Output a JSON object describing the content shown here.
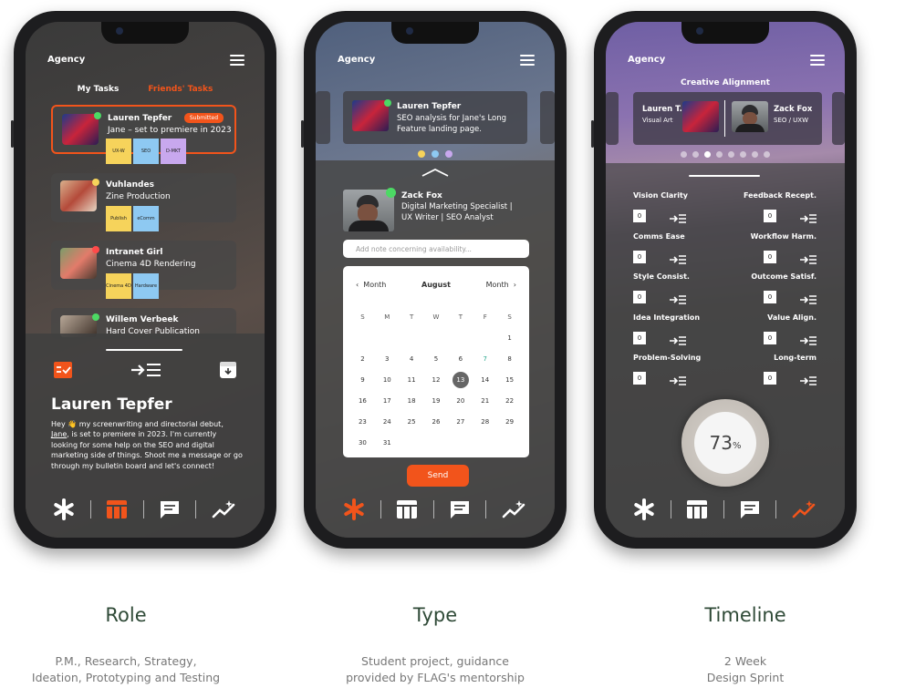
{
  "phone1": {
    "brand": "Agency",
    "tabs": [
      "My Tasks",
      "Friends' Tasks"
    ],
    "cards": [
      {
        "name": "Lauren Tepfer",
        "desc": "Jane – set to premiere in 2023",
        "badge": "Submitted",
        "stickies": [
          "UX-W",
          "SEO",
          "D-MKT"
        ]
      },
      {
        "name": "Vuhlandes",
        "desc": "Zine Production",
        "stickies": [
          "Publish",
          "eComm"
        ]
      },
      {
        "name": "Intranet Girl",
        "desc": "Cinema 4D Rendering",
        "stickies": [
          "Cinema 4D",
          "Hardware"
        ]
      },
      {
        "name": "Willem Verbeek",
        "desc": "Hard Cover Publication"
      }
    ],
    "detail_name": "Lauren Tepfer",
    "message_start": "Hey 👋 my screenwriting and directorial debut,",
    "message_link": "Jane",
    "message_end": ", is set to premiere in 2023. I'm currently looking for some help on the SEO and digital marketing side of things. Shoot me a message or go through my bulletin board and let's connect!"
  },
  "phone2": {
    "brand": "Agency",
    "top_card": {
      "name": "Lauren Tepfer",
      "desc_line1": "SEO analysis for Jane's Long",
      "desc_line2": "Feature landing page."
    },
    "profile": {
      "name": "Zack Fox",
      "line1": "Digital Marketing Specialist |",
      "line2": "UX Writer | SEO Analyst"
    },
    "note_placeholder": "Add note concerning availability...",
    "calendar": {
      "prev_label": "Month",
      "month": "August",
      "next_label": "Month",
      "weekdays": [
        "S",
        "M",
        "T",
        "W",
        "T",
        "F",
        "S"
      ],
      "cells": [
        "",
        "",
        "",
        "",
        "",
        "",
        "1",
        "2",
        "3",
        "4",
        "5",
        "6",
        "7",
        "8",
        "9",
        "10",
        "11",
        "12",
        "13",
        "14",
        "15",
        "16",
        "17",
        "18",
        "19",
        "20",
        "21",
        "22",
        "23",
        "24",
        "25",
        "26",
        "27",
        "28",
        "29",
        "30",
        "31"
      ],
      "selected": "13",
      "highlighted": "7"
    },
    "send_label": "Send"
  },
  "phone3": {
    "brand": "Agency",
    "title": "Creative Alignment",
    "left_person": {
      "name": "Lauren T.",
      "role": "Visual Art"
    },
    "right_person": {
      "name": "Zack Fox",
      "role": "SEO / UXW"
    },
    "metrics": [
      {
        "left": "Vision Clarity",
        "left_value": "0",
        "right": "Feedback Recept.",
        "right_value": "0"
      },
      {
        "left": "Comms Ease",
        "left_value": "0",
        "right": "Workflow Harm.",
        "right_value": "0"
      },
      {
        "left": "Style Consist.",
        "left_value": "0",
        "right": "Outcome Satisf.",
        "right_value": "0"
      },
      {
        "left": "Idea Integration",
        "left_value": "0",
        "right": "Value Align.",
        "right_value": "0"
      },
      {
        "left": "Problem-Solving",
        "left_value": "0",
        "right": "Long-term",
        "right_value": "0"
      }
    ],
    "score": "73",
    "score_unit": "%"
  },
  "captions": [
    {
      "title": "Role",
      "line1": "P.M., Research, Strategy,",
      "line2": "Ideation, Prototyping and Testing"
    },
    {
      "title": "Type",
      "line1": "Student project, guidance",
      "line2": "provided by FLAG's mentorship"
    },
    {
      "title": "Timeline",
      "line1": "2 Week",
      "line2": "Design Sprint"
    }
  ],
  "colors": {
    "accent": "#f2541b",
    "caption_title": "#2f4a37",
    "online": "#4cd964"
  }
}
